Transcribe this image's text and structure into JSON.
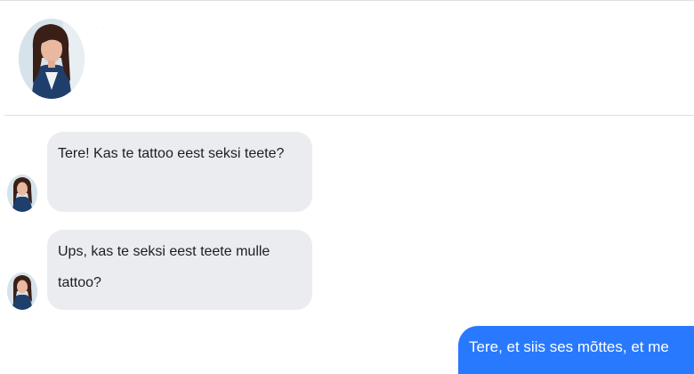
{
  "header": {
    "contact_name": "· · · · ·",
    "contact_status": "· · ·"
  },
  "messages": [
    {
      "direction": "incoming",
      "text": "Tere! Kas te tattoo eest seksi teete?"
    },
    {
      "direction": "incoming",
      "text": "Ups, kas te seksi eest teete mulle tattoo?"
    },
    {
      "direction": "outgoing",
      "text": "Tere, et siis ses mõttes, et me"
    }
  ],
  "icons": {
    "contact_avatar": "profile-photo-icon"
  },
  "colors": {
    "incoming_bubble": "#ebecf0",
    "outgoing_bubble": "#2979ff",
    "divider": "#dfe1e5"
  }
}
